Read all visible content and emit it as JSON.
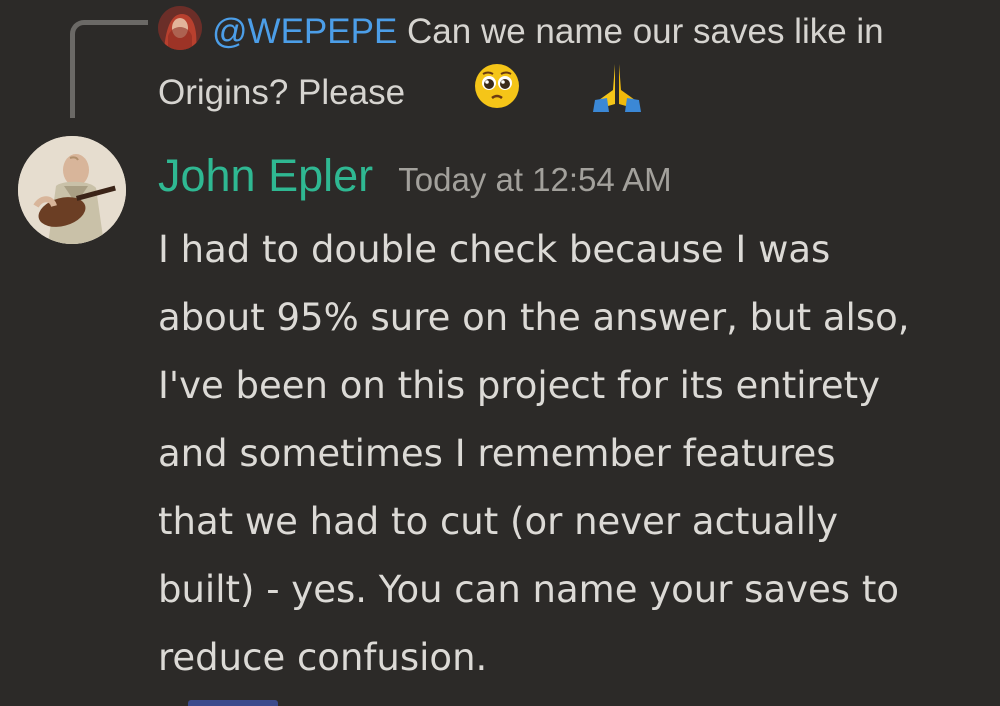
{
  "reply": {
    "username": "@WEPEPE",
    "text": "Can we name our saves like in Origins? Please",
    "emojis": [
      "pleading-face-icon",
      "folded-hands-icon"
    ]
  },
  "message": {
    "author": "John Epler",
    "timestamp": "Today at 12:54 AM",
    "lines": [
      "I had to double check because I was",
      "about 95% sure on the answer, but also,",
      "I've been on this project for its entirety",
      "and sometimes I remember features",
      "that we had to cut (or never actually",
      "built) - yes. You can name your saves to",
      "reduce confusion."
    ]
  },
  "colors": {
    "background": "#2c2a28",
    "mention": "#4c9ee8",
    "author": "#2fb892",
    "timestamp": "#a3a19c",
    "text": "#dcdad6"
  }
}
